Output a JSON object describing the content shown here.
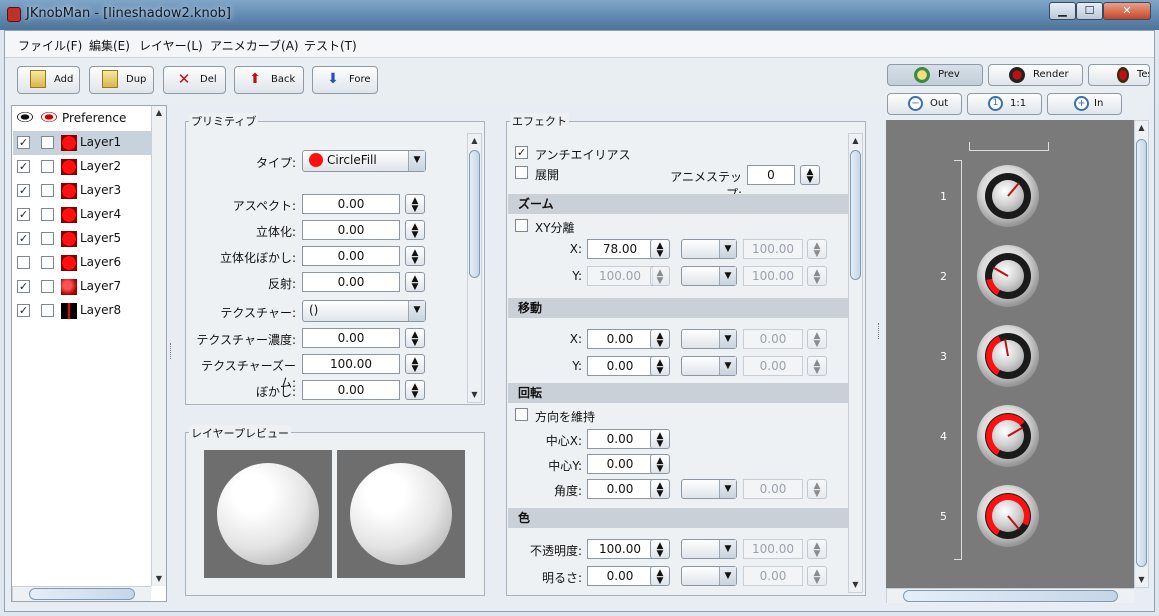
{
  "window": {
    "title": "JKnobMan - [lineshadow2.knob]",
    "minimize": "▁",
    "maximize": "☐",
    "close": "✕"
  },
  "menu": [
    "ファイル(F)",
    "編集(E)",
    "レイヤー(L)",
    "アニメカーブ(A)",
    "テスト(T)"
  ],
  "toolbar": {
    "add": "Add",
    "dup": "Dup",
    "del": "Del",
    "back": "Back",
    "fore": "Fore"
  },
  "layers": {
    "preference": "Preference",
    "items": [
      {
        "name": "Layer1",
        "visible": true,
        "solo": false,
        "selected": true
      },
      {
        "name": "Layer2",
        "visible": true,
        "solo": false
      },
      {
        "name": "Layer3",
        "visible": true,
        "solo": false
      },
      {
        "name": "Layer4",
        "visible": true,
        "solo": false
      },
      {
        "name": "Layer5",
        "visible": true,
        "solo": false
      },
      {
        "name": "Layer6",
        "visible": false,
        "solo": false
      },
      {
        "name": "Layer7",
        "visible": true,
        "solo": false
      },
      {
        "name": "Layer8",
        "visible": true,
        "solo": false
      }
    ]
  },
  "primitive": {
    "title": "プリミティブ",
    "type_label": "タイプ:",
    "type_value": "CircleFill",
    "rows": [
      {
        "label": "アスペクト:",
        "value": "0.00"
      },
      {
        "label": "立体化:",
        "value": "0.00"
      },
      {
        "label": "立体化ぼかし:",
        "value": "0.00"
      },
      {
        "label": "反射:",
        "value": "0.00"
      }
    ],
    "texture_label": "テクスチャー:",
    "texture_value": "()",
    "rows2": [
      {
        "label": "テクスチャー濃度:",
        "value": "0.00"
      },
      {
        "label": "テクスチャーズーム:",
        "value": "100.00"
      },
      {
        "label": "ぼかし:",
        "value": "0.00"
      }
    ]
  },
  "layer_preview": {
    "title": "レイヤープレビュー"
  },
  "effect": {
    "title": "エフェクト",
    "antialias": {
      "label": "アンチエイリアス",
      "checked": true
    },
    "expand": {
      "label": "展開",
      "checked": false
    },
    "animstep": {
      "label": "アニメステップ:",
      "value": "0"
    },
    "zoom": {
      "header": "ズーム",
      "xy_label": "XY分離",
      "x_label": "X:",
      "x_value": "78.00",
      "x_extra": "100.00",
      "y_label": "Y:",
      "y_value": "100.00",
      "y_extra": "100.00"
    },
    "move": {
      "header": "移動",
      "x_label": "X:",
      "x_value": "0.00",
      "x_extra": "0.00",
      "y_label": "Y:",
      "y_value": "0.00",
      "y_extra": "0.00"
    },
    "rotate": {
      "header": "回転",
      "keep_label": "方向を維持",
      "cx_label": "中心X:",
      "cx_value": "0.00",
      "cy_label": "中心Y:",
      "cy_value": "0.00",
      "angle_label": "角度:",
      "angle_value": "0.00",
      "angle_extra": "0.00"
    },
    "color": {
      "header": "色",
      "opacity_label": "不透明度:",
      "opacity_value": "100.00",
      "opacity_extra": "100.00",
      "bright_label": "明るさ:",
      "bright_value": "0.00",
      "bright_extra": "0.00"
    }
  },
  "preview": {
    "tabs": [
      "Prev",
      "Render",
      "Tes"
    ],
    "zoom": {
      "out": "Out",
      "one": "1:1",
      "in": "In"
    },
    "frames": [
      "1",
      "2",
      "3",
      "4",
      "5"
    ]
  },
  "colors": {
    "accent": "#ff0000",
    "preview_bg": "#7a7a7a",
    "layer_preview_bg": "#6e6e6e"
  }
}
